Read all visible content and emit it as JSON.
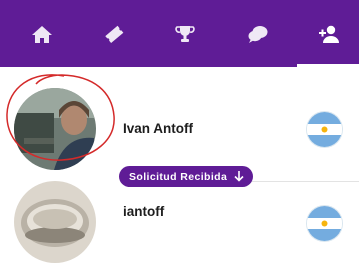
{
  "tabs": [
    {
      "icon": "home-icon"
    },
    {
      "icon": "ticket-icon"
    },
    {
      "icon": "trophy-icon"
    },
    {
      "icon": "chat-bubbles-icon"
    },
    {
      "icon": "add-user-icon",
      "active": true
    }
  ],
  "colors": {
    "header": "#5f1c96",
    "badge": "#5f1c96"
  },
  "contacts": [
    {
      "name": "Ivan Antoff",
      "flag": "argentina-flag"
    },
    {
      "name": "iantoff",
      "flag": "argentina-flag",
      "badge": "Solicitud Recibida"
    }
  ]
}
